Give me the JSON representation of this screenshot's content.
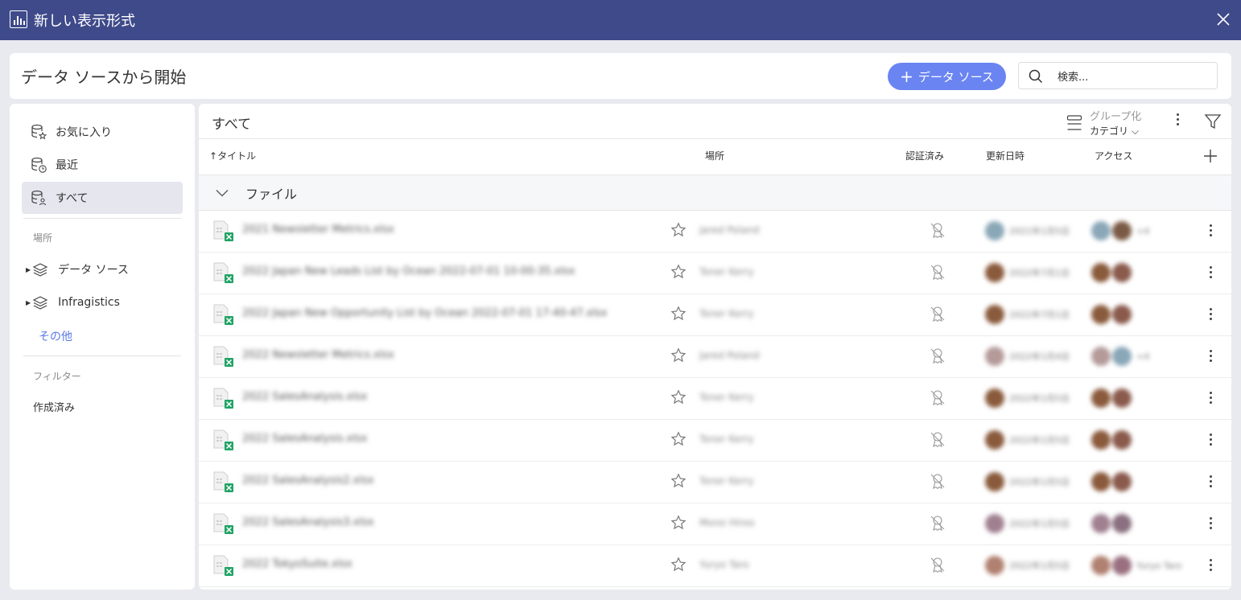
{
  "window": {
    "title": "新しい表示形式"
  },
  "header": {
    "title": "データ ソースから開始",
    "add_datasource_label": "データ ソース",
    "search_placeholder": "検索..."
  },
  "sidebar": {
    "nav": [
      {
        "label": "お気に入り",
        "icon": "favorites-icon"
      },
      {
        "label": "最近",
        "icon": "recent-icon"
      },
      {
        "label": "すべて",
        "icon": "all-icon",
        "active": true
      }
    ],
    "location_label": "場所",
    "locations": [
      {
        "label": "データ ソース"
      },
      {
        "label": "Infragistics"
      }
    ],
    "more_label": "その他",
    "filter_label": "フィルター",
    "filters": [
      {
        "label": "作成済み"
      }
    ]
  },
  "main": {
    "title": "すべて",
    "group_by": {
      "label": "グループ化",
      "value": "カテゴリ"
    },
    "columns": {
      "title": "タイトル",
      "location": "場所",
      "certified": "認証済み",
      "updated": "更新日時",
      "access": "アクセス"
    },
    "group_name": "ファイル",
    "rows": [
      {
        "name": "2021 Newsletter Metrics.xlsx",
        "location": "Jared Poland",
        "updated": "2021年1月5日",
        "access_extra": "+4"
      },
      {
        "name": "2022 Japan New Leads List by Ocean 2022-07-01 10-00-35.xlsx",
        "location": "Toner Kerry",
        "updated": "2022年7月1日",
        "access_extra": ""
      },
      {
        "name": "2022 Japan New Opportunity List by Ocean 2022-07-01 17-40-47.xlsx",
        "location": "Toner Kerry",
        "updated": "2022年7月1日",
        "access_extra": ""
      },
      {
        "name": "2022 Newsletter Metrics.xlsx",
        "location": "Jared Poland",
        "updated": "2022年1月4日",
        "access_extra": "+4"
      },
      {
        "name": "2022 SalesAnalysis.xlsx",
        "location": "Toner Kerry",
        "updated": "2022年1月5日",
        "access_extra": ""
      },
      {
        "name": "2022 SalesAnalysis.xlsx",
        "location": "Toner Kerry",
        "updated": "2022年1月5日",
        "access_extra": ""
      },
      {
        "name": "2022 SalesAnalysis2.xlsx",
        "location": "Toner Kerry",
        "updated": "2022年1月5日",
        "access_extra": ""
      },
      {
        "name": "2022 SalesAnalysis3.xlsx",
        "location": "Moroi Hiroo",
        "updated": "2022年1月5日",
        "access_extra": ""
      },
      {
        "name": "2022 TokyoSuite.xlsx",
        "location": "Yuryo Taro",
        "updated": "2022年1月5日",
        "access_extra": "Yuryo Taro"
      }
    ]
  },
  "colors": {
    "titlebar": "#3f4a8a",
    "accent": "#6a84f2",
    "link": "#5a78e6",
    "excel_green": "#21a366",
    "active_nav": "#e5e6ee"
  }
}
